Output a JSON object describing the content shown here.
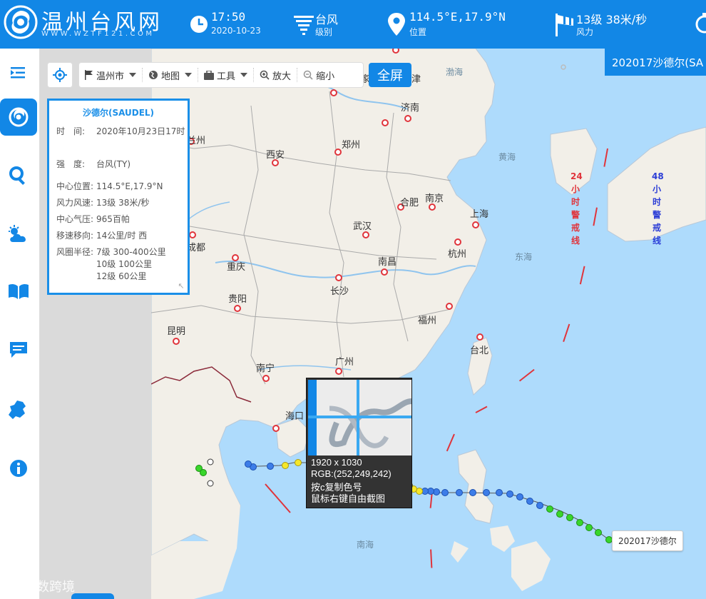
{
  "header": {
    "brand": "温州台风网",
    "brand_sub": "WWW.WZTF121.COM",
    "time": {
      "value": "17:50",
      "label": "2020-10-23"
    },
    "level": {
      "value": "台风",
      "label": "级别"
    },
    "position": {
      "value": "114.5°E,17.9°N",
      "label": "位置"
    },
    "wind": {
      "value": "13级 38米/秒",
      "label": "风力"
    }
  },
  "toolbar": {
    "city": "温州市",
    "map": "地图",
    "tools": "工具",
    "zoom_in": "放大",
    "zoom_out": "缩小",
    "fullscreen": "全屏"
  },
  "panel": {
    "title": "沙德尔(SAUDEL)",
    "rows": [
      {
        "k": "时　间:",
        "v": "2020年10月23日17时"
      },
      {
        "k": "强　度:",
        "v": "台风(TY)"
      },
      {
        "k": "中心位置:",
        "v": "114.5°E,17.9°N"
      },
      {
        "k": "风力风速:",
        "v": "13级 38米/秒"
      },
      {
        "k": "中心气压:",
        "v": "965百帕"
      },
      {
        "k": "移速移向:",
        "v": "14公里/时 西"
      },
      {
        "k": "风圈半径:",
        "v": "7级 300-400公里"
      },
      {
        "k": "",
        "v": "10级 100公里"
      },
      {
        "k": "",
        "v": "12级 60公里"
      }
    ]
  },
  "typhoon_tab": "202017沙德尔(SA",
  "track_label": "202017沙德尔",
  "map": {
    "cities": [
      {
        "name": "济南"
      },
      {
        "name": "郑州"
      },
      {
        "name": "西安"
      },
      {
        "name": "合肥"
      },
      {
        "name": "南京"
      },
      {
        "name": "上海"
      },
      {
        "name": "武汉"
      },
      {
        "name": "杭州"
      },
      {
        "name": "成都"
      },
      {
        "name": "重庆"
      },
      {
        "name": "南昌"
      },
      {
        "name": "长沙"
      },
      {
        "name": "贵阳"
      },
      {
        "name": "福州"
      },
      {
        "name": "昆明"
      },
      {
        "name": "台北"
      },
      {
        "name": "南宁"
      },
      {
        "name": "广州"
      },
      {
        "name": "海口"
      },
      {
        "name": "兰州"
      },
      {
        "name": "家"
      },
      {
        "name": "津"
      }
    ],
    "seas": [
      "渤海",
      "黄海",
      "东海",
      "南海"
    ],
    "warn24": "24小时警戒线",
    "warn48": "48小时警戒线"
  },
  "picker": {
    "size": "1920 x 1030",
    "rgb": "RGB:(252,249,242)",
    "hint1": "按c复制色号",
    "hint2": "鼠标右键自由截图"
  },
  "watermark": "大数跨境",
  "colors": {
    "accent": "#1287e6",
    "land": "#f2efe8",
    "sea": "#aedbfc",
    "warn24": "#e0343b",
    "warn48": "#2b3dd6"
  }
}
